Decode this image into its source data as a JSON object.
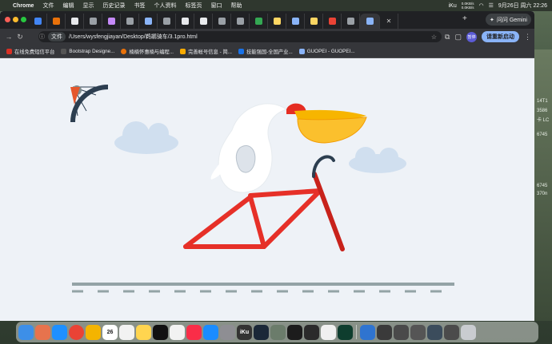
{
  "menubar": {
    "app_name": "Chrome",
    "items": [
      "文件",
      "编辑",
      "显示",
      "历史记录",
      "书签",
      "个人资料",
      "标签页",
      "窗口",
      "帮助"
    ],
    "clock": "9月26日 周六 22:26",
    "iku_label": "iKu",
    "net_top": "0.0KB/s",
    "net_bottom": "0.0KB/s"
  },
  "browser": {
    "gemini_label": "问问 Gemini",
    "url_chip": "文件",
    "url": "/Users/wysfengjiayan/Desktop/鹈鹕骑车/3.1pro.html",
    "avatar_text": "暂停",
    "update_label": "请重新启动",
    "bookmarks": [
      {
        "label": "在线免费短信平台",
        "color": "#d93025"
      },
      {
        "label": "Bootstrap Designe...",
        "color": "#555"
      },
      {
        "label": "楠楠怀惠楠与编程...",
        "color": "#e8710a"
      },
      {
        "label": "完善帐号信息 - 简...",
        "color": "#f9ab00"
      },
      {
        "label": "技能强国-全国产业...",
        "color": "#1a73e8"
      },
      {
        "label": "GUOPEI - GUOPEI...",
        "color": "#8ab4f8"
      }
    ]
  },
  "side_texts": [
    "14T1",
    "3586",
    "卡 LC",
    "6745",
    "6745",
    "370n"
  ],
  "dock": {
    "icons": [
      {
        "name": "finder-icon",
        "color": "#3d8fe8"
      },
      {
        "name": "launchpad-icon",
        "color": "#e7734d"
      },
      {
        "name": "safari-icon",
        "color": "#1e90ff"
      },
      {
        "name": "chrome-icon",
        "color": "#ea4335"
      },
      {
        "name": "photos-icon",
        "color": "#f4b400"
      },
      {
        "name": "calendar-icon",
        "color": "#ffffff"
      },
      {
        "name": "reminders-icon",
        "color": "#f2f2f2"
      },
      {
        "name": "notes-icon",
        "color": "#ffd54f"
      },
      {
        "name": "tv-icon",
        "color": "#111111"
      },
      {
        "name": "freeform-icon",
        "color": "#f2f2f2"
      },
      {
        "name": "music-icon",
        "color": "#fa2d48"
      },
      {
        "name": "app-store-icon",
        "color": "#1a8cff"
      },
      {
        "name": "system-settings-icon",
        "color": "#8e8e93"
      },
      {
        "name": "iku-icon",
        "color": "#333333"
      },
      {
        "name": "steam-icon",
        "color": "#1b2838"
      },
      {
        "name": "preview-icon",
        "color": "#6b7c6b"
      },
      {
        "name": "terminal-icon",
        "color": "#1c1c1c"
      },
      {
        "name": "save-icon",
        "color": "#2b2b2b"
      },
      {
        "name": "textedit-icon",
        "color": "#f0f0f0"
      },
      {
        "name": "monitor-icon",
        "color": "#0e3d2e"
      }
    ],
    "calendar_day": "26",
    "iku_label": "iKu",
    "right_icons": [
      {
        "name": "downloads-icon",
        "color": "#2f74d0"
      },
      {
        "name": "screenshot-icon",
        "color": "#3a3a3a"
      },
      {
        "name": "window-thumb-icon",
        "color": "#4a4a4a"
      },
      {
        "name": "window-thumb-icon-2",
        "color": "#555555"
      },
      {
        "name": "window-thumb-icon-3",
        "color": "#3b4c5c"
      },
      {
        "name": "window-thumb-icon-4",
        "color": "#4b4b4b"
      },
      {
        "name": "trash-icon",
        "color": "#c9ccd0"
      }
    ]
  },
  "scene": {
    "clouds": "#d0dfef",
    "frame": "#e63028",
    "bird_body": "#ffffff",
    "beak_top": "#f7b500",
    "crest": "#e52d22",
    "road": "#93a3a6",
    "wheel": "#2c3e50"
  }
}
